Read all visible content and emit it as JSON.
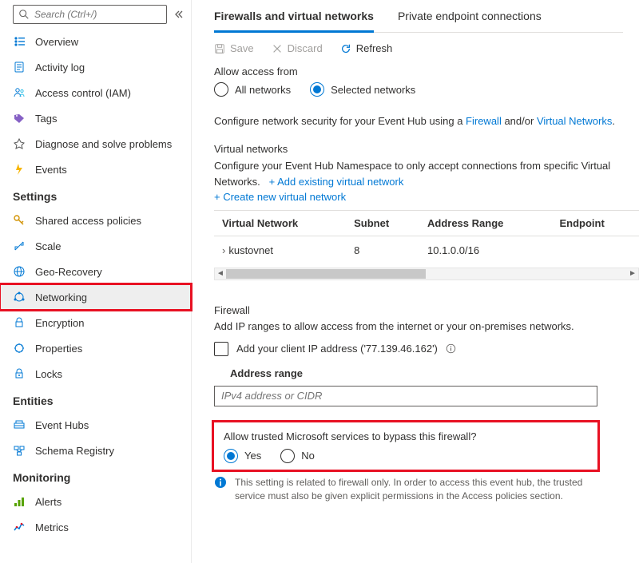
{
  "colors": {
    "accent": "#0078d4",
    "highlight": "#e81123"
  },
  "sidebar": {
    "search_placeholder": "Search (Ctrl+/)",
    "top": [
      {
        "icon": "overview",
        "label": "Overview"
      },
      {
        "icon": "activity",
        "label": "Activity log"
      },
      {
        "icon": "iam",
        "label": "Access control (IAM)"
      },
      {
        "icon": "tags",
        "label": "Tags"
      },
      {
        "icon": "diagnose",
        "label": "Diagnose and solve problems"
      },
      {
        "icon": "events",
        "label": "Events"
      }
    ],
    "groups": [
      {
        "header": "Settings",
        "highlight_index": 3,
        "items": [
          {
            "icon": "key",
            "label": "Shared access policies"
          },
          {
            "icon": "scale",
            "label": "Scale"
          },
          {
            "icon": "geo",
            "label": "Geo-Recovery"
          },
          {
            "icon": "network",
            "label": "Networking"
          },
          {
            "icon": "lock",
            "label": "Encryption"
          },
          {
            "icon": "props",
            "label": "Properties"
          },
          {
            "icon": "locks",
            "label": "Locks"
          }
        ]
      },
      {
        "header": "Entities",
        "items": [
          {
            "icon": "eventhubs",
            "label": "Event Hubs"
          },
          {
            "icon": "schema",
            "label": "Schema Registry"
          }
        ]
      },
      {
        "header": "Monitoring",
        "items": [
          {
            "icon": "alerts",
            "label": "Alerts"
          },
          {
            "icon": "metrics",
            "label": "Metrics"
          }
        ]
      }
    ]
  },
  "tabs": [
    {
      "label": "Firewalls and virtual networks",
      "active": true
    },
    {
      "label": "Private endpoint connections",
      "active": false
    }
  ],
  "toolbar": {
    "save": "Save",
    "discard": "Discard",
    "refresh": "Refresh"
  },
  "access": {
    "label": "Allow access from",
    "options": [
      {
        "label": "All networks",
        "selected": false
      },
      {
        "label": "Selected networks",
        "selected": true
      }
    ]
  },
  "description": {
    "pre": "Configure network security for your Event Hub using a ",
    "link1": "Firewall",
    "mid": " and/or ",
    "link2": "Virtual Networks",
    "post": "."
  },
  "vnet": {
    "header": "Virtual networks",
    "desc_line": "Configure your Event Hub Namespace to only accept connections from specific Virtual Networks.",
    "add_existing": "+ Add existing virtual network",
    "create_new": "+ Create new virtual network",
    "columns": [
      "Virtual Network",
      "Subnet",
      "Address Range",
      "Endpoint"
    ],
    "rows": [
      {
        "name": "kustovnet",
        "subnet": "8",
        "range": "10.1.0.0/16",
        "endpoint": ""
      }
    ]
  },
  "firewall": {
    "header": "Firewall",
    "desc": "Add IP ranges to allow access from the internet or your on-premises networks.",
    "client_ip_label": "Add your client IP address ('77.139.46.162')",
    "address_range_label": "Address range",
    "placeholder": "IPv4 address or CIDR"
  },
  "trusted": {
    "question": "Allow trusted Microsoft services to bypass this firewall?",
    "yes": "Yes",
    "no": "No",
    "selected": "Yes"
  },
  "info_note": "This setting is related to firewall only. In order to access this event hub, the trusted service must also be given explicit permissions in the Access policies section."
}
